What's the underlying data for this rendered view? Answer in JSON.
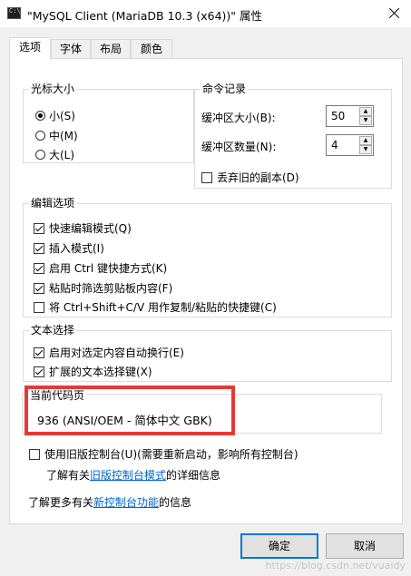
{
  "window": {
    "title": "\"MySQL Client (MariaDB 10.3 (x64))\" 属性",
    "icon": "console-icon",
    "close_icon": "close-icon"
  },
  "tabs": [
    {
      "label": "选项",
      "active": true
    },
    {
      "label": "字体",
      "active": false
    },
    {
      "label": "布局",
      "active": false
    },
    {
      "label": "颜色",
      "active": false
    }
  ],
  "cursor_size": {
    "title": "光标大小",
    "options": [
      {
        "label": "小(S)",
        "selected": true
      },
      {
        "label": "中(M)",
        "selected": false
      },
      {
        "label": "大(L)",
        "selected": false
      }
    ]
  },
  "command_history": {
    "title": "命令记录",
    "buffer_size_label": "缓冲区大小(B):",
    "buffer_size_value": "50",
    "buffer_count_label": "缓冲区数量(N):",
    "buffer_count_value": "4",
    "discard_duplicates": {
      "label": "丢弃旧的副本(D)",
      "checked": false
    }
  },
  "edit_options": {
    "title": "编辑选项",
    "items": [
      {
        "label": "快速编辑模式(Q)",
        "checked": true
      },
      {
        "label": "插入模式(I)",
        "checked": true
      },
      {
        "label": "启用 Ctrl 键快捷方式(K)",
        "checked": true
      },
      {
        "label": "粘贴时筛选剪贴板内容(F)",
        "checked": true
      },
      {
        "label": "将 Ctrl+Shift+C/V 用作复制/粘贴的快捷键(C)",
        "checked": false
      }
    ]
  },
  "text_selection": {
    "title": "文本选择",
    "items": [
      {
        "label": "启用对选定内容自动换行(E)",
        "checked": true
      },
      {
        "label": "扩展的文本选择键(X)",
        "checked": true
      }
    ]
  },
  "code_page": {
    "title": "当前代码页",
    "value": "936   (ANSI/OEM - 简体中文 GBK)",
    "highlight_color": "#e53935"
  },
  "legacy_console": {
    "label": "使用旧版控制台(U)(需要重新启动，影响所有控制台)",
    "checked": false,
    "info_prefix": "了解有关",
    "info_link": "旧版控制台模式",
    "info_suffix": "的详细信息"
  },
  "new_console_info": {
    "prefix": "了解更多有关",
    "link": "新控制台功能",
    "suffix": "的信息"
  },
  "buttons": {
    "ok": "确定",
    "cancel": "取消"
  },
  "watermark": "https://blog.csdn.net/vuaidy"
}
